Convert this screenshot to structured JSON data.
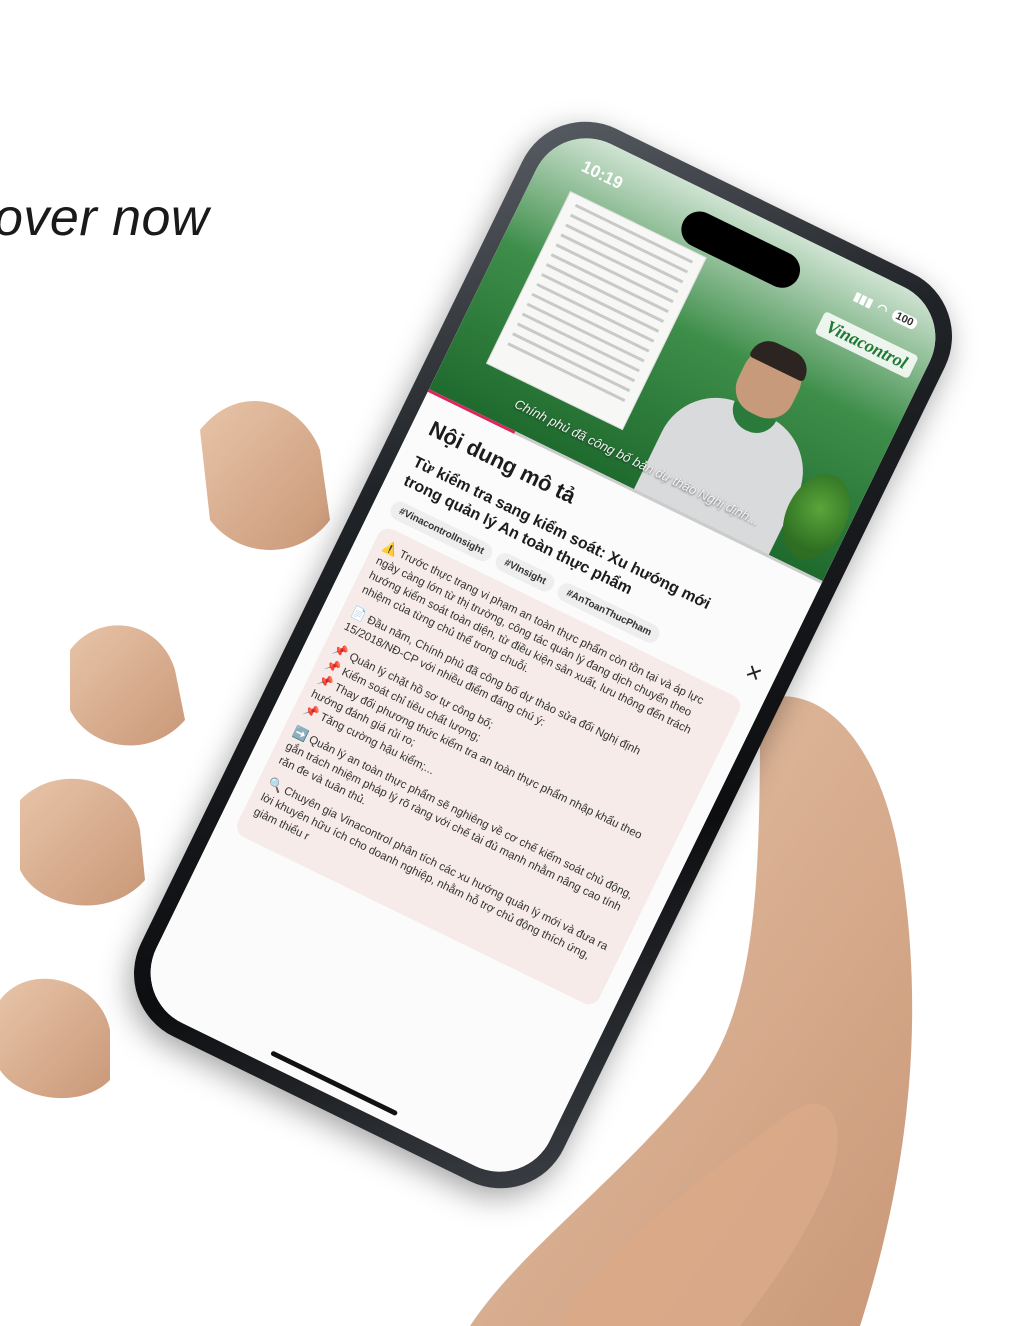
{
  "headline": "over now",
  "status": {
    "time": "10:19",
    "battery": "100"
  },
  "video": {
    "brand": "Vinacontrol",
    "caption": "Chính phủ đã công bố bản dự thảo Nghị định..."
  },
  "sheet": {
    "title": "Nội dung mô tả",
    "close_icon": "×",
    "post_title": "Từ kiểm tra sang kiểm soát: Xu hướng mới trong quản lý An toàn thực phẩm",
    "tags": [
      "#VinacontrolInsight",
      "#VInsight",
      "#AnToanThucPham"
    ],
    "paragraphs": [
      {
        "icon": "⚠️",
        "text": "Trước thực trạng vi phạm an toàn thực phẩm còn tồn tại và áp lực ngày càng lớn từ thị trường, công tác quản lý đang dịch chuyển theo hướng kiểm soát toàn diện, từ điều kiện sản xuất, lưu thông đến trách nhiệm của từng chủ thể trong chuỗi."
      },
      {
        "icon": "📄",
        "text": "Đầu năm, Chính phủ đã công bố dự thảo sửa đổi Nghị định 15/2018/NĐ-CP với nhiều điểm đáng chú ý:"
      }
    ],
    "bullets": [
      "Quản lý chặt hồ sơ tự công bố;",
      "Kiểm soát chỉ tiêu chất lượng;",
      "Thay đổi phương thức kiểm tra an toàn thực phẩm nhập khẩu theo hướng đánh giá rủi ro;",
      "Tăng cường hậu kiểm;..."
    ],
    "bullet_icon": "📌",
    "paragraphs2": [
      {
        "icon": "➡️",
        "text": "Quản lý an toàn thực phẩm sẽ nghiêng về cơ chế kiểm soát chủ động, gắn trách nhiệm pháp lý rõ ràng với chế tài đủ mạnh nhằm nâng cao tính răn đe và tuân thủ."
      },
      {
        "icon": "🔍",
        "text": "Chuyên gia Vinacontrol phân tích các xu hướng quản lý mới và đưa ra lời khuyên hữu ích cho doanh nghiệp, nhằm hỗ trợ chủ động thích ứng, giảm thiểu r"
      }
    ]
  }
}
